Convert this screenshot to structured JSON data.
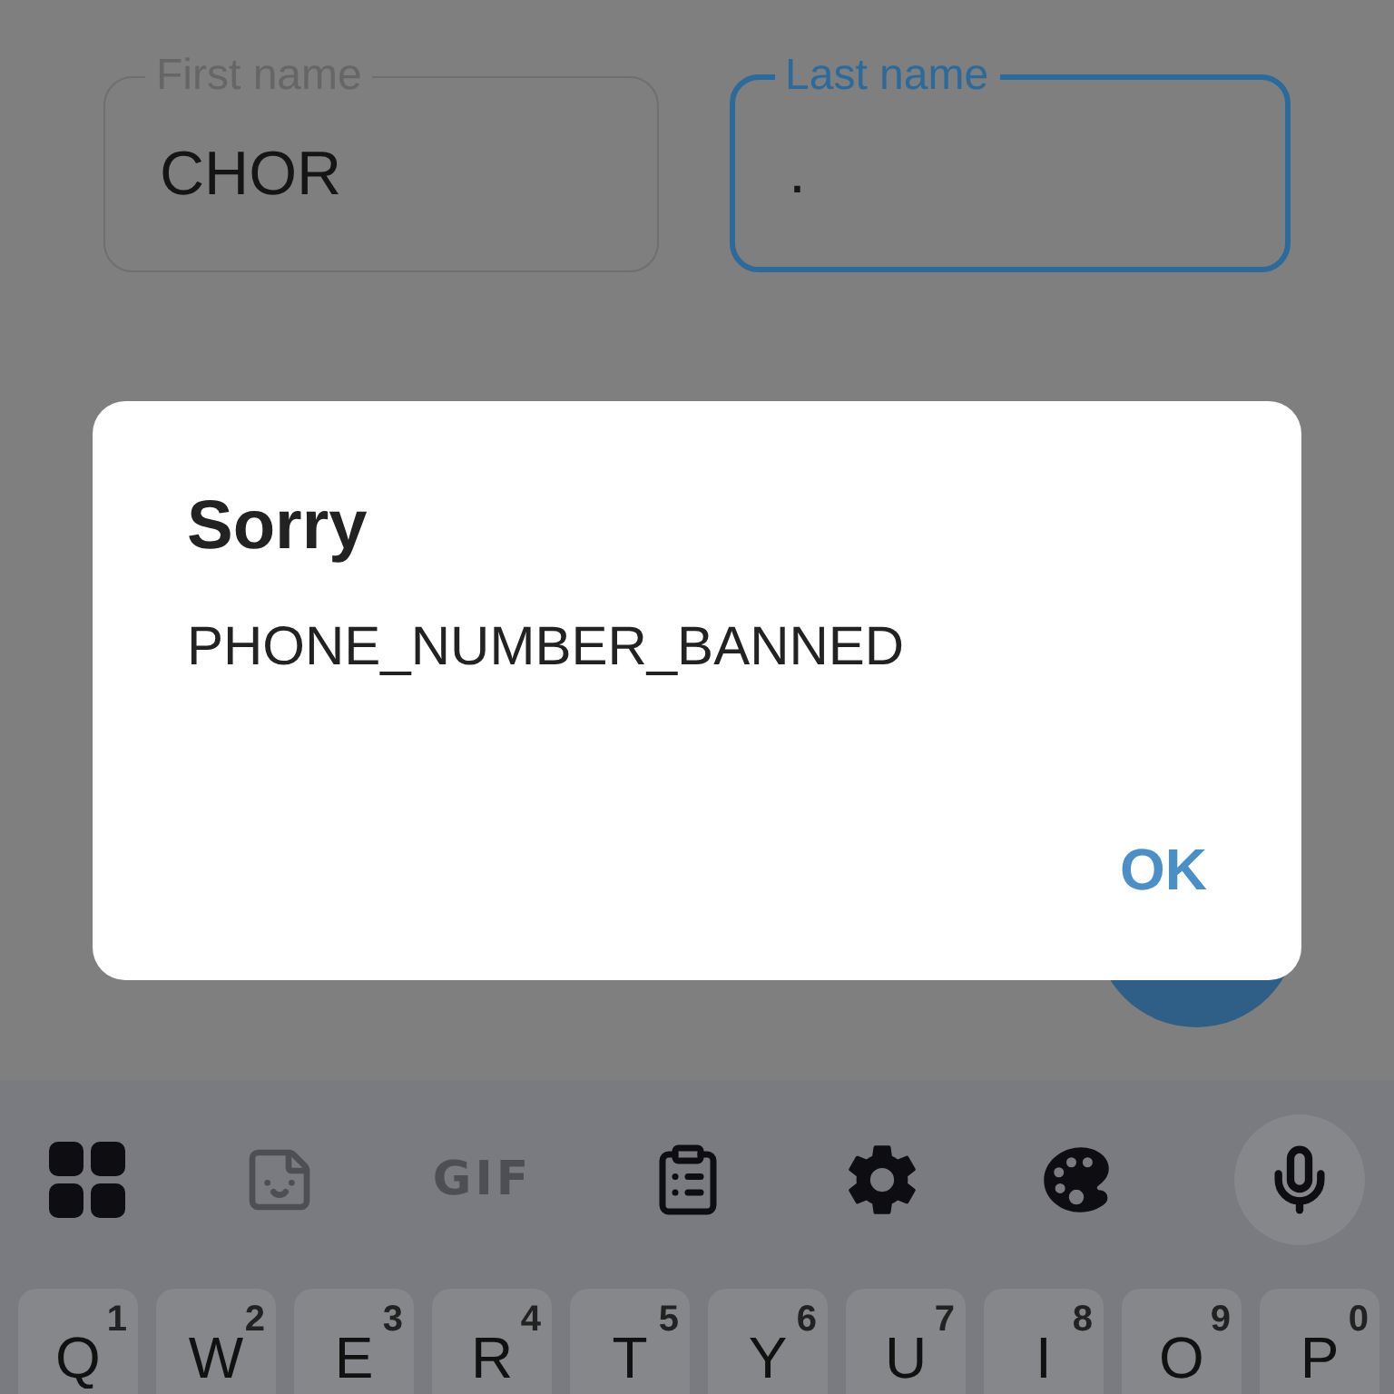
{
  "fields": [
    {
      "label": "First name",
      "value": "CHOR",
      "focused": false
    },
    {
      "label": "Last name",
      "value": ".",
      "focused": true
    }
  ],
  "dialog": {
    "title": "Sorry",
    "message": "PHONE_NUMBER_BANNED",
    "button": "OK"
  },
  "keyboard": {
    "toolbar": [
      {
        "kind": "icon",
        "disabled": false
      },
      {
        "kind": "icon",
        "disabled": true
      },
      {
        "kind": "text",
        "label": "GIF",
        "disabled": true
      },
      {
        "kind": "icon",
        "disabled": false
      },
      {
        "kind": "icon",
        "disabled": false
      },
      {
        "kind": "icon",
        "disabled": false
      },
      {
        "kind": "round",
        "disabled": false
      }
    ],
    "keys": [
      {
        "letter": "Q",
        "hint": "1"
      },
      {
        "letter": "W",
        "hint": "2"
      },
      {
        "letter": "E",
        "hint": "3"
      },
      {
        "letter": "R",
        "hint": "4"
      },
      {
        "letter": "T",
        "hint": "5"
      },
      {
        "letter": "Y",
        "hint": "6"
      },
      {
        "letter": "U",
        "hint": "7"
      },
      {
        "letter": "I",
        "hint": "8"
      },
      {
        "letter": "O",
        "hint": "9"
      },
      {
        "letter": "P",
        "hint": "0"
      }
    ]
  }
}
